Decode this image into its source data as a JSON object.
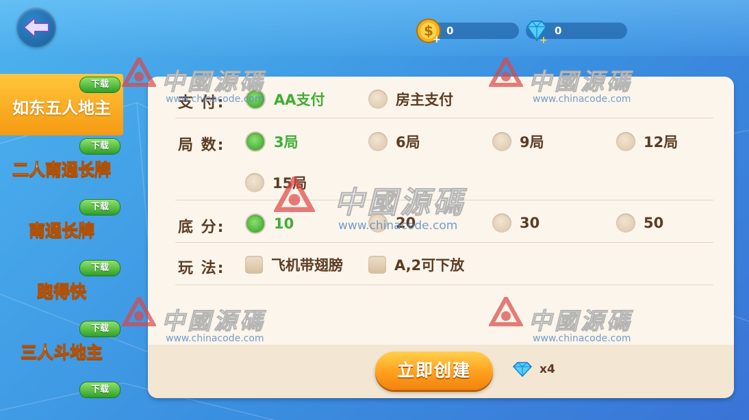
{
  "header": {
    "coins": "0",
    "gems": "0"
  },
  "sidebar": {
    "badge": "下载",
    "items": [
      {
        "label": "如东五人地主",
        "active": true
      },
      {
        "label": "二人南通长牌",
        "active": false
      },
      {
        "label": "南通长牌",
        "active": false
      },
      {
        "label": "跑得快",
        "active": false
      },
      {
        "label": "三人斗地主",
        "active": false
      },
      {
        "label": "",
        "active": false
      }
    ]
  },
  "settings": {
    "payment": {
      "label": "支 付:",
      "options": [
        {
          "label": "AA支付",
          "selected": true
        },
        {
          "label": "房主支付",
          "selected": false
        }
      ]
    },
    "rounds": {
      "label": "局 数:",
      "options": [
        {
          "label": "3局",
          "selected": true
        },
        {
          "label": "6局",
          "selected": false
        },
        {
          "label": "9局",
          "selected": false
        },
        {
          "label": "12局",
          "selected": false
        },
        {
          "label": "15局",
          "selected": false
        }
      ]
    },
    "base": {
      "label": "底 分:",
      "options": [
        {
          "label": "10",
          "selected": true
        },
        {
          "label": "20",
          "selected": false
        },
        {
          "label": "30",
          "selected": false
        },
        {
          "label": "50",
          "selected": false
        }
      ]
    },
    "rules": {
      "label": "玩 法:",
      "options": [
        {
          "label": "飞机带翅膀",
          "checked": false
        },
        {
          "label": "A,2可下放",
          "checked": false
        }
      ]
    }
  },
  "footer": {
    "create_label": "立即创建",
    "cost": "x4"
  },
  "watermark": {
    "text": "中國源碼",
    "url": "www.chinacode.com"
  },
  "colors": {
    "selected_green": "#3fae33",
    "text_brown": "#5c3c22",
    "accent_orange": "#f59a12"
  }
}
